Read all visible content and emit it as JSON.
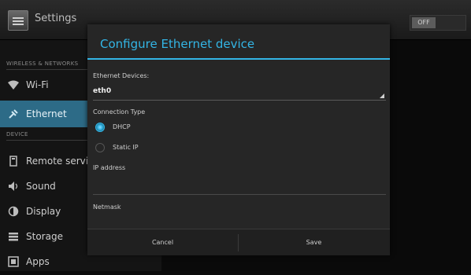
{
  "app": {
    "title": "Settings",
    "toggle": "OFF"
  },
  "sidebar": {
    "sections": [
      "WIRELESS & NETWORKS",
      "DEVICE"
    ],
    "items": [
      {
        "label": "Wi-Fi",
        "icon": "wifi-icon"
      },
      {
        "label": "Ethernet",
        "icon": "ethernet-icon",
        "selected": true
      },
      {
        "label": "Remote servi",
        "icon": "remote-icon"
      },
      {
        "label": "Sound",
        "icon": "sound-icon"
      },
      {
        "label": "Display",
        "icon": "display-icon"
      },
      {
        "label": "Storage",
        "icon": "storage-icon"
      },
      {
        "label": "Apps",
        "icon": "apps-icon"
      }
    ]
  },
  "dialog": {
    "title": "Configure Ethernet device",
    "device_label": "Ethernet Devices:",
    "device_value": "eth0",
    "connection_label": "Connection Type",
    "options": [
      {
        "label": "DHCP",
        "checked": true
      },
      {
        "label": "Static IP",
        "checked": false
      }
    ],
    "ip_label": "IP address",
    "netmask_label": "Netmask",
    "cancel": "Cancel",
    "save": "Save"
  },
  "colors": {
    "accent": "#33b5e5",
    "selected_bg": "#2d6b87"
  }
}
